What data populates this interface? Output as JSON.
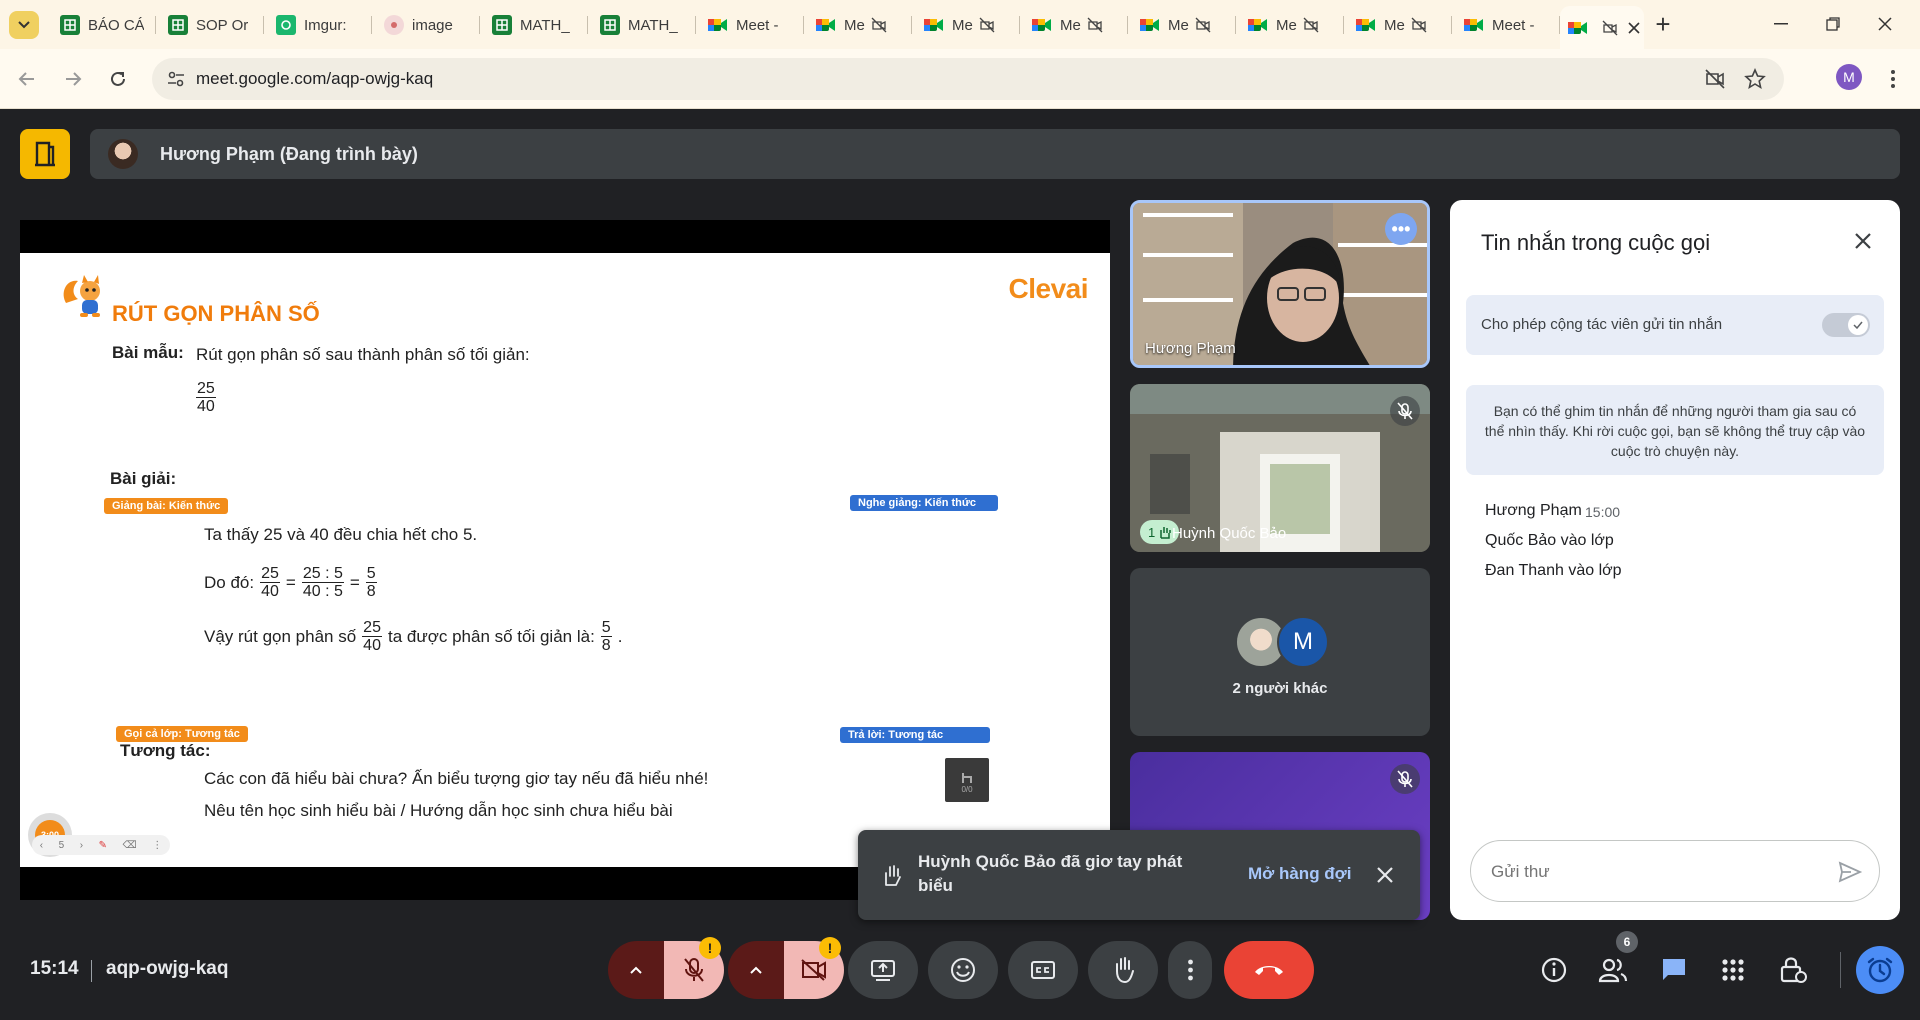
{
  "browser": {
    "tabs": [
      {
        "label": "BÁO CÁ",
        "icon": "sheets-icon"
      },
      {
        "label": "SOP Or",
        "icon": "sheets-icon"
      },
      {
        "label": "Imgur:",
        "icon": "imgur-icon"
      },
      {
        "label": "image",
        "icon": "image-icon"
      },
      {
        "label": "MATH_",
        "icon": "sheets-icon"
      },
      {
        "label": "MATH_",
        "icon": "sheets-icon"
      },
      {
        "label": "Meet -",
        "icon": "meet-icon"
      },
      {
        "label": "Me",
        "icon": "meet-icon",
        "muted": true
      },
      {
        "label": "Me",
        "icon": "meet-icon",
        "muted": true
      },
      {
        "label": "Me",
        "icon": "meet-icon",
        "muted": true
      },
      {
        "label": "Me",
        "icon": "meet-icon",
        "muted": true
      },
      {
        "label": "Me",
        "icon": "meet-icon",
        "muted": true
      },
      {
        "label": "Me",
        "icon": "meet-icon",
        "muted": true
      },
      {
        "label": "Meet -",
        "icon": "meet-icon"
      }
    ],
    "url": "meet.google.com/aqp-owjg-kaq",
    "profile_initial": "M"
  },
  "header": {
    "presenter": "Hương Phạm (Đang trình bày)"
  },
  "slide": {
    "brand": "Clevai",
    "title": "RÚT GỌN PHÂN SỐ",
    "example_label": "Bài mẫu:",
    "example_text": "Rút gọn phân số sau thành phân số tối giản:",
    "fraction_num": "25",
    "fraction_den": "40",
    "solution_label": "Bài giải:",
    "tag_teach": "Giảng bài: Kiến thức",
    "tag_listen": "Nghe giảng: Kiến thức",
    "line1": "Ta thấy 25 và 40 đều chia hết cho 5.",
    "line2_prefix": "Do đó:",
    "line2_mid_num": "25 : 5",
    "line2_mid_den": "40 : 5",
    "line2_res_num": "5",
    "line2_res_den": "8",
    "line3_prefix": "Vậy rút gọn phân số",
    "line3_mid": "ta được phân số tối giản là:",
    "tag_call": "Gọi cả lớp: Tương tác",
    "tag_answer": "Trả lời: Tương tác",
    "interact_label": "Tương tác:",
    "interact_line1": "Các con đã hiểu bài chưa? Ấn biểu tượng giơ tay nếu đã hiểu nhé!",
    "interact_line2": "Nêu tên học sinh hiểu bài / Hướng dẫn học sinh chưa hiểu bài",
    "timer": "3:00",
    "page": "5",
    "hand_count": "0/0"
  },
  "tiles": {
    "tile1_name": "Hương Phạm",
    "tile2_hand": "1",
    "tile2_name": "Huỳnh Quốc Bảo",
    "tile3_initial": "M",
    "tile3_label": "2 người khác"
  },
  "chat": {
    "title": "Tin nhắn trong cuộc gọi",
    "allow_label": "Cho phép cộng tác viên gửi tin nhắn",
    "allow_enabled": true,
    "info": "Bạn có thể ghim tin nhắn để những người tham gia sau có thể nhìn thấy. Khi rời cuộc gọi, bạn sẽ không thể truy cập vào cuộc trò chuyện này.",
    "message_author": "Hương Phạm",
    "message_time": "15:00",
    "message_lines": [
      "Quốc Bảo vào lớp",
      "Đan Thanh vào lớp"
    ],
    "input_placeholder": "Gửi thư"
  },
  "toast": {
    "text": "Huỳnh Quốc Bảo đã giơ tay phát biểu",
    "action": "Mở hàng đợi"
  },
  "bottom": {
    "time": "15:14",
    "meeting_code": "aqp-owjg-kaq",
    "people_count": "6",
    "warn_symbol": "!"
  }
}
